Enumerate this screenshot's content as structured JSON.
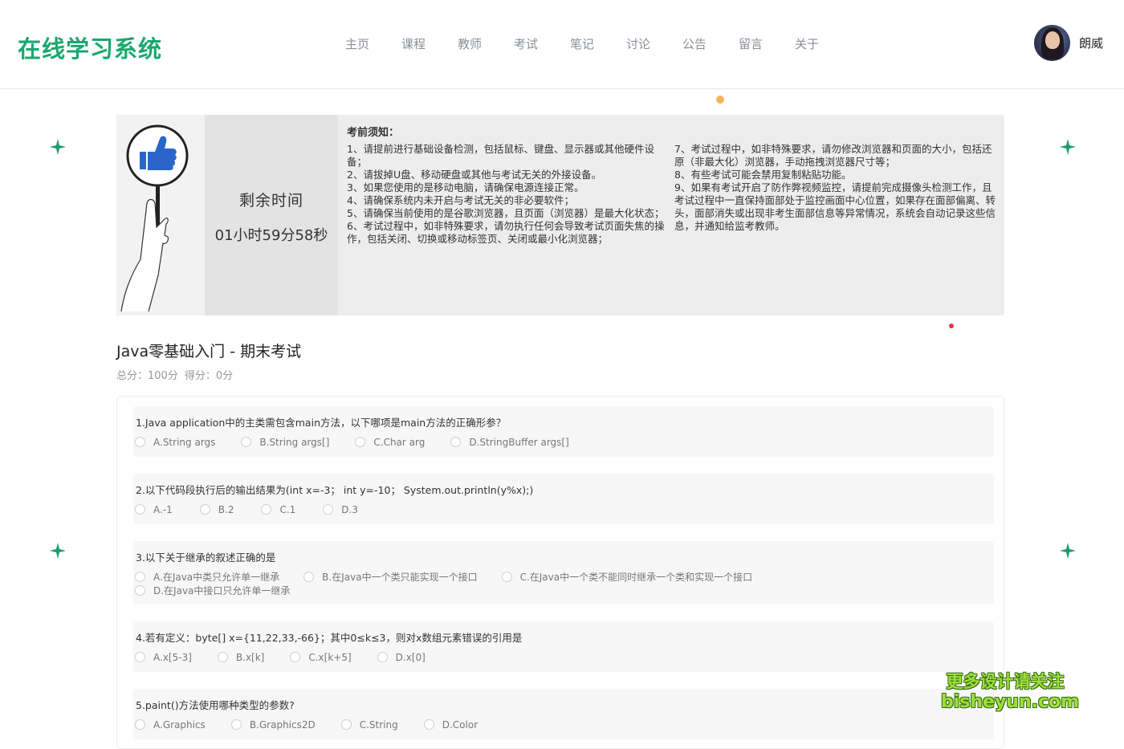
{
  "app": {
    "title": "在线学习系统"
  },
  "nav": {
    "items": [
      {
        "label": "主页"
      },
      {
        "label": "课程"
      },
      {
        "label": "教师"
      },
      {
        "label": "考试"
      },
      {
        "label": "笔记"
      },
      {
        "label": "讨论"
      },
      {
        "label": "公告"
      },
      {
        "label": "留言"
      },
      {
        "label": "关于"
      }
    ]
  },
  "user": {
    "name": "朗威"
  },
  "timer": {
    "label": "剩余时间",
    "value": "01小时59分58秒"
  },
  "notice": {
    "title": "考前须知：",
    "left": [
      "1、请提前进行基础设备检测，包括鼠标、键盘、显示器或其他硬件设备；",
      "2、请拔掉U盘、移动硬盘或其他与考试无关的外接设备。",
      "3、如果您使用的是移动电脑，请确保电源连接正常。",
      "4、请确保系统内未开启与考试无关的非必要软件；",
      "5、请确保当前使用的是谷歌浏览器，且页面（浏览器）是最大化状态；",
      "6、考试过程中，如非特殊要求，请勿执行任何会导致考试页面失焦的操作，包括关闭、切换或移动标签页、关闭或最小化浏览器；"
    ],
    "right": [
      "7、考试过程中，如非特殊要求，请勿修改浏览器和页面的大小，包括还原（非最大化）浏览器，手动拖拽浏览器尺寸等；",
      "8、有些考试可能会禁用复制粘贴功能。",
      "9、如果有考试开启了防作弊视频监控，请提前完成摄像头检测工作，且考试过程中一直保持面部处于监控画面中心位置，如果存在面部偏离、转头，面部消失或出现非考生面部信息等异常情况，系统会自动记录这些信息，并通知给监考教师。"
    ]
  },
  "exam": {
    "title": "Java零基础入门 - 期末考试",
    "total": "总分：100分",
    "score": "得分：0分"
  },
  "questions": [
    {
      "text": "1.Java application中的主类需包含main方法，以下哪项是main方法的正确形参？",
      "options": [
        "A.String args",
        "B.String args[]",
        "C.Char arg",
        "D.StringBuffer args[]"
      ]
    },
    {
      "text": "2.以下代码段执行后的输出结果为(int x=-3；  int y=-10；  System.out.println(y%x);)",
      "options": [
        "A.-1",
        "B.2",
        "C.1",
        "D.3"
      ]
    },
    {
      "text": "3.以下关于继承的叙述正确的是",
      "options": [
        "A.在Java中类只允许单一继承",
        "B.在Java中一个类只能实现一个接口",
        "C.在Java中一个类不能同时继承一个类和实现一个接口",
        "D.在Java中接口只允许单一继承"
      ]
    },
    {
      "text": "4.若有定义：byte[] x={11,22,33,-66}；其中0≤k≤3，则对x数组元素错误的引用是",
      "options": [
        "A.x[5-3]",
        "B.x[k]",
        "C.x[k+5]",
        "D.x[0]"
      ]
    },
    {
      "text": "5.paint()方法使用哪种类型的参数?",
      "options": [
        "A.Graphics",
        "B.Graphics2D",
        "C.String",
        "D.Color"
      ]
    }
  ],
  "watermark": {
    "line1": "更多设计请关注",
    "line2": "bisheyun.com"
  },
  "colors": {
    "brand": "#1aa86e",
    "accent_dot": "#f5a623",
    "red_dot": "#e8333f"
  }
}
